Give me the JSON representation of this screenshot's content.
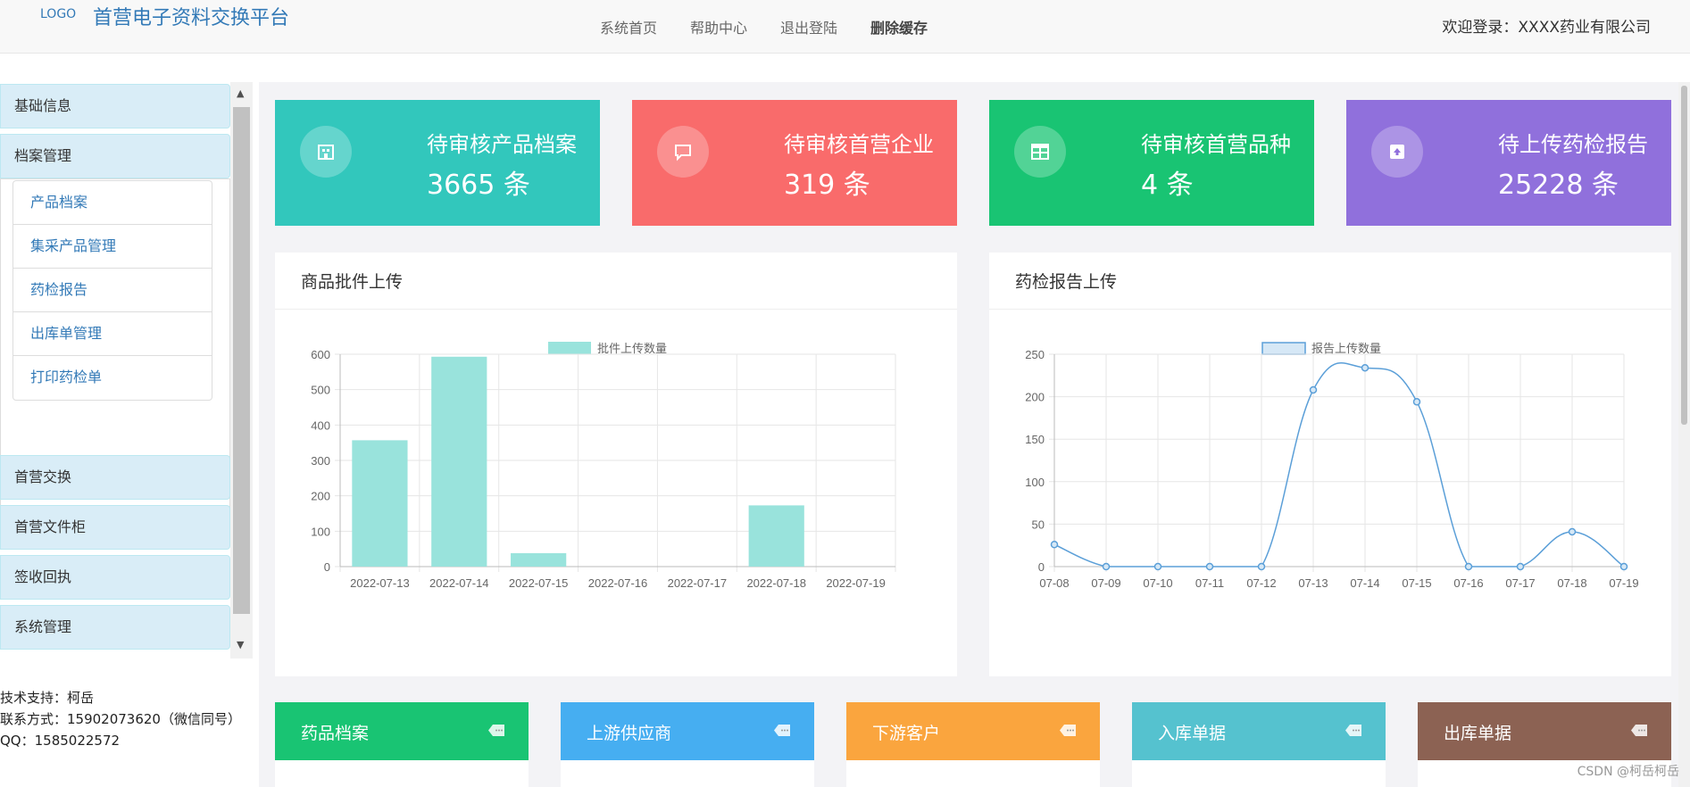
{
  "header": {
    "logo": "LOGO",
    "title": "首营电子资料交换平台",
    "nav": [
      "系统首页",
      "帮助中心",
      "退出登陆",
      "删除缓存"
    ],
    "welcome": "欢迎登录：XXXX药业有限公司"
  },
  "sidebar": {
    "menu": [
      "基础信息",
      "档案管理",
      "首营交换",
      "首营文件柜",
      "签收回执",
      "系统管理"
    ],
    "submenu": [
      "产品档案",
      "集采产品管理",
      "药检报告",
      "出库单管理",
      "打印药检单"
    ],
    "support": [
      "技术支持：柯岳",
      "联系方式：15902073620（微信同号）",
      "QQ：1585022572"
    ]
  },
  "stats": [
    {
      "title": "待审核产品档案",
      "count": "3665 条",
      "color": "#32c7bc",
      "icon": "building-icon"
    },
    {
      "title": "待审核首营企业",
      "count": "319 条",
      "color": "#f96b6b",
      "icon": "chat-icon"
    },
    {
      "title": "待审核首营品种",
      "count": "4 条",
      "color": "#19c473",
      "icon": "table-icon"
    },
    {
      "title": "待上传药检报告",
      "count": "25228 条",
      "color": "#9070dc",
      "icon": "upload-icon"
    }
  ],
  "panels": {
    "left_title": "商品批件上传",
    "right_title": "药检报告上传"
  },
  "tiles": [
    {
      "label": "药品档案",
      "color": "#19c473"
    },
    {
      "label": "上游供应商",
      "color": "#46aef1"
    },
    {
      "label": "下游客户",
      "color": "#faa53e"
    },
    {
      "label": "入库单据",
      "color": "#55c2cf"
    },
    {
      "label": "出库单据",
      "color": "#8c6253"
    }
  ],
  "watermark": "CSDN @柯岳柯岳",
  "chart_data": [
    {
      "type": "bar",
      "legend": "批件上传数量",
      "categories": [
        "2022-07-13",
        "2022-07-14",
        "2022-07-15",
        "2022-07-16",
        "2022-07-17",
        "2022-07-18",
        "2022-07-19"
      ],
      "values": [
        357,
        593,
        38,
        0,
        0,
        173,
        0
      ],
      "ylim": [
        0,
        600
      ],
      "yticks": [
        0,
        100,
        200,
        300,
        400,
        500,
        600
      ],
      "color": "#99e3dc",
      "grid": true,
      "legend_position": "top"
    },
    {
      "type": "line",
      "legend": "报告上传数量",
      "categories": [
        "07-08",
        "07-09",
        "07-10",
        "07-11",
        "07-12",
        "07-13",
        "07-14",
        "07-15",
        "07-16",
        "07-17",
        "07-18",
        "07-19"
      ],
      "values": [
        26,
        0,
        0,
        0,
        0,
        208,
        234,
        194,
        0,
        0,
        41,
        0
      ],
      "ylim": [
        0,
        250
      ],
      "yticks": [
        0,
        50,
        100,
        150,
        200,
        250
      ],
      "color": "#5b9fd8",
      "grid": true,
      "legend_position": "top"
    }
  ]
}
